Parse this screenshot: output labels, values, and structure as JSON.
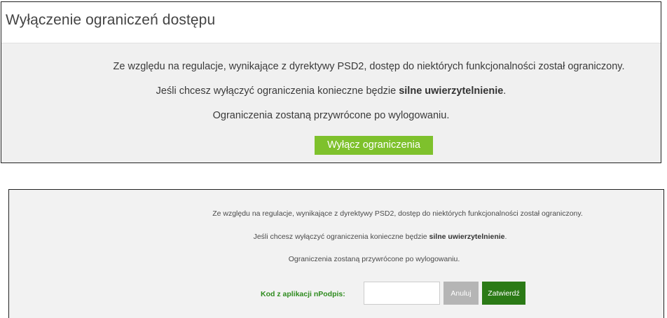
{
  "panel1": {
    "title": "Wyłączenie ograniczeń dostępu",
    "line1": "Ze względu na regulacje, wynikające z dyrektywy PSD2, dostęp do niektórych funkcjonalności został ograniczony.",
    "line2_prefix": "Jeśli chcesz wyłączyć ograniczenia konieczne będzie ",
    "line2_bold": "silne uwierzytelnienie",
    "line2_suffix": ".",
    "line3": "Ograniczenia zostaną przywrócone po wylogowaniu.",
    "button_label": "Wyłącz ograniczenia"
  },
  "panel2": {
    "line1": "Ze względu na regulacje, wynikające z dyrektywy PSD2, dostęp do niektórych funkcjonalności został ograniczony.",
    "line2_prefix": "Jeśli chcesz wyłączyć ograniczenia konieczne będzie ",
    "line2_bold": "silne uwierzytelnienie",
    "line2_suffix": ".",
    "line3": "Ograniczenia zostaną przywrócone po wylogowaniu.",
    "code_label": "Kod z aplikacji nPodpis:",
    "code_value": "",
    "cancel_label": "Anuluj",
    "confirm_label": "Zatwierdź"
  },
  "colors": {
    "accent_green": "#7ec12c",
    "confirm_green": "#2b7a16",
    "label_green": "#2e8b1e",
    "cancel_gray": "#b5b5b5",
    "panel_bg": "#f0f0f0"
  }
}
